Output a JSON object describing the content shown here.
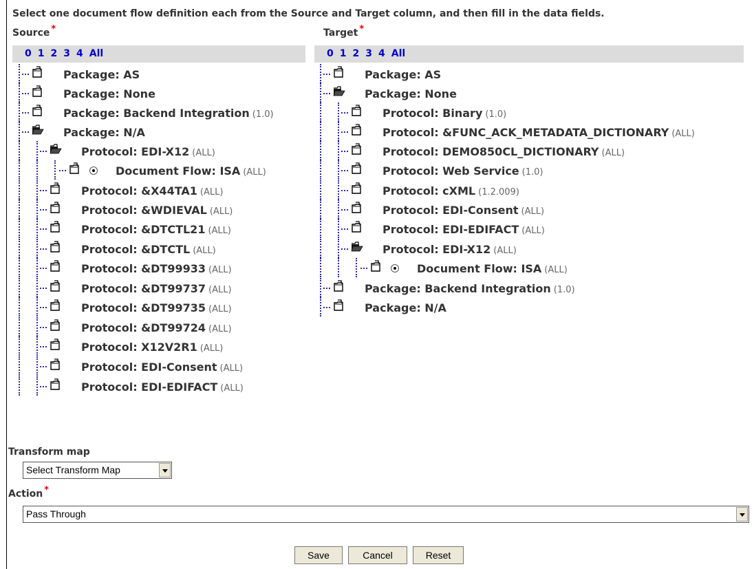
{
  "instructions": "Select one document flow definition each from the Source and Target column, and then fill in the data fields.",
  "source": {
    "title": "Source",
    "required_mark": "*",
    "levels": [
      "0",
      "1",
      "2",
      "3",
      "4",
      "All"
    ],
    "nodes": [
      {
        "label": "Package: AS",
        "version": ""
      },
      {
        "label": "Package: None",
        "version": ""
      },
      {
        "label": "Package: Backend Integration",
        "version": "(1.0)"
      },
      {
        "label": "Package: N/A",
        "version": ""
      },
      {
        "label": "Protocol: EDI-X12",
        "version": "(ALL)"
      },
      {
        "label": "Document Flow: ISA",
        "version": "(ALL)"
      },
      {
        "label": "Protocol: &X44TA1",
        "version": "(ALL)"
      },
      {
        "label": "Protocol: &WDIEVAL",
        "version": "(ALL)"
      },
      {
        "label": "Protocol: &DTCTL21",
        "version": "(ALL)"
      },
      {
        "label": "Protocol: &DTCTL",
        "version": "(ALL)"
      },
      {
        "label": "Protocol: &DT99933",
        "version": "(ALL)"
      },
      {
        "label": "Protocol: &DT99737",
        "version": "(ALL)"
      },
      {
        "label": "Protocol: &DT99735",
        "version": "(ALL)"
      },
      {
        "label": "Protocol: &DT99724",
        "version": "(ALL)"
      },
      {
        "label": "Protocol: X12V2R1",
        "version": "(ALL)"
      },
      {
        "label": "Protocol: EDI-Consent",
        "version": "(ALL)"
      },
      {
        "label": "Protocol: EDI-EDIFACT",
        "version": "(ALL)"
      }
    ]
  },
  "target": {
    "title": "Target",
    "required_mark": "*",
    "levels": [
      "0",
      "1",
      "2",
      "3",
      "4",
      "All"
    ],
    "nodes": [
      {
        "label": "Package: AS",
        "version": ""
      },
      {
        "label": "Package: None",
        "version": ""
      },
      {
        "label": "Protocol: Binary",
        "version": "(1.0)"
      },
      {
        "label": "Protocol: &FUNC_ACK_METADATA_DICTIONARY",
        "version": "(ALL)"
      },
      {
        "label": "Protocol: DEMO850CL_DICTIONARY",
        "version": "(ALL)"
      },
      {
        "label": "Protocol: Web Service",
        "version": "(1.0)"
      },
      {
        "label": "Protocol: cXML",
        "version": "(1.2.009)"
      },
      {
        "label": "Protocol: EDI-Consent",
        "version": "(ALL)"
      },
      {
        "label": "Protocol: EDI-EDIFACT",
        "version": "(ALL)"
      },
      {
        "label": "Protocol: EDI-X12",
        "version": "(ALL)"
      },
      {
        "label": "Document Flow: ISA",
        "version": "(ALL)"
      },
      {
        "label": "Package: Backend Integration",
        "version": "(1.0)"
      },
      {
        "label": "Package: N/A",
        "version": ""
      }
    ]
  },
  "transform_map": {
    "label": "Transform map",
    "value": "Select Transform Map"
  },
  "action": {
    "label": "Action",
    "required_mark": "*",
    "value": "Pass Through"
  },
  "buttons": {
    "save": "Save",
    "cancel": "Cancel",
    "reset": "Reset"
  }
}
